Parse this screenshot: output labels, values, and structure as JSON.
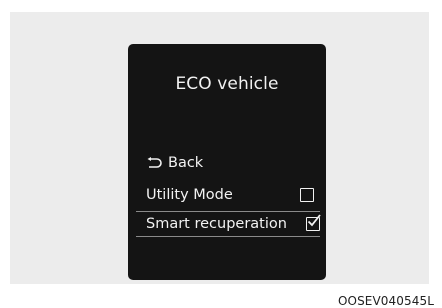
{
  "screen": {
    "title": "ECO vehicle",
    "back_label": "Back",
    "items": [
      {
        "label": "Utility Mode",
        "checked": false
      },
      {
        "label": "Smart recuperation",
        "checked": true
      }
    ]
  },
  "caption": "OOSEV040545L",
  "icons": {
    "back": "back-arrow-icon",
    "unchecked": "checkbox-unchecked-icon",
    "checked": "checkbox-checked-icon"
  },
  "colors": {
    "screen_bg": "#141414",
    "text": "#f2f2f2",
    "selection_border": "#8a8a8a"
  }
}
